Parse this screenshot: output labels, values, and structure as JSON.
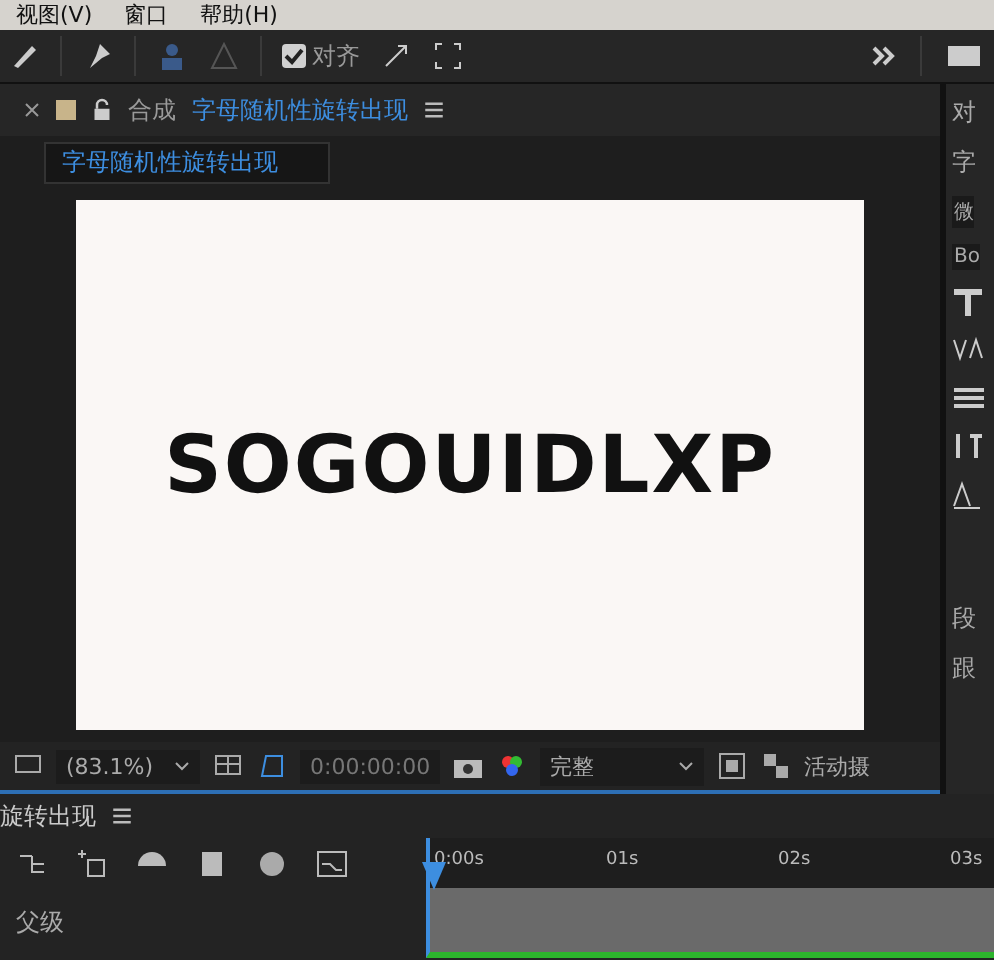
{
  "menu_bar": [
    "视图(V)",
    "窗口",
    "帮助(H)"
  ],
  "toolbar": {
    "snap": {
      "label": "对齐",
      "checked": true
    }
  },
  "composition_panel": {
    "label": "合成",
    "name": "字母随机性旋转出现",
    "subtab": "字母随机性旋转出现",
    "canvas_text": "SOGOUIDLXP",
    "viewer_bar": {
      "zoom": "(83.1%)",
      "timecode": "0:00:00:00",
      "resolution": "完整",
      "camera": "活动摄"
    }
  },
  "right_panel": {
    "top_tab": "对",
    "section": "字",
    "font_family": "微",
    "font_style": "Bo",
    "paragraph": "段",
    "tracker": "跟"
  },
  "timeline": {
    "tab": "旋转出现",
    "ruler": [
      "0:00s",
      "01s",
      "02s",
      "03s"
    ],
    "column": "父级"
  }
}
